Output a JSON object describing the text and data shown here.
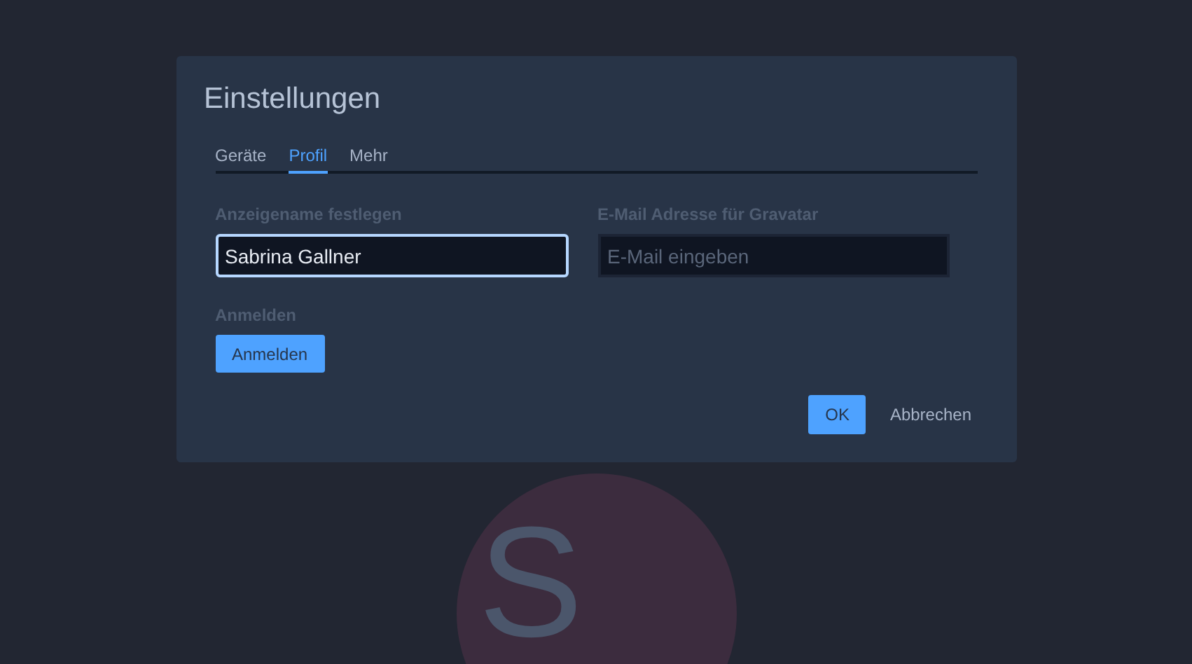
{
  "dialog": {
    "title": "Einstellungen",
    "tabs": [
      {
        "label": "Geräte",
        "selected": false
      },
      {
        "label": "Profil",
        "selected": true
      },
      {
        "label": "Mehr",
        "selected": false
      }
    ],
    "fields": [
      {
        "label": "Anzeigename festlegen",
        "value": "Sabrina Gallner",
        "focused": true
      },
      {
        "label": "E-Mail Adresse für Gravatar",
        "placeholder": "E-Mail eingeben",
        "focused": false
      }
    ],
    "login": {
      "label": "Anmelden",
      "button": "Anmelden"
    },
    "buttons": [
      {
        "label": "OK",
        "kind": "primary"
      },
      {
        "label": "Abbrechen",
        "kind": "plain"
      }
    ]
  },
  "avatar": {
    "initials": "S"
  }
}
